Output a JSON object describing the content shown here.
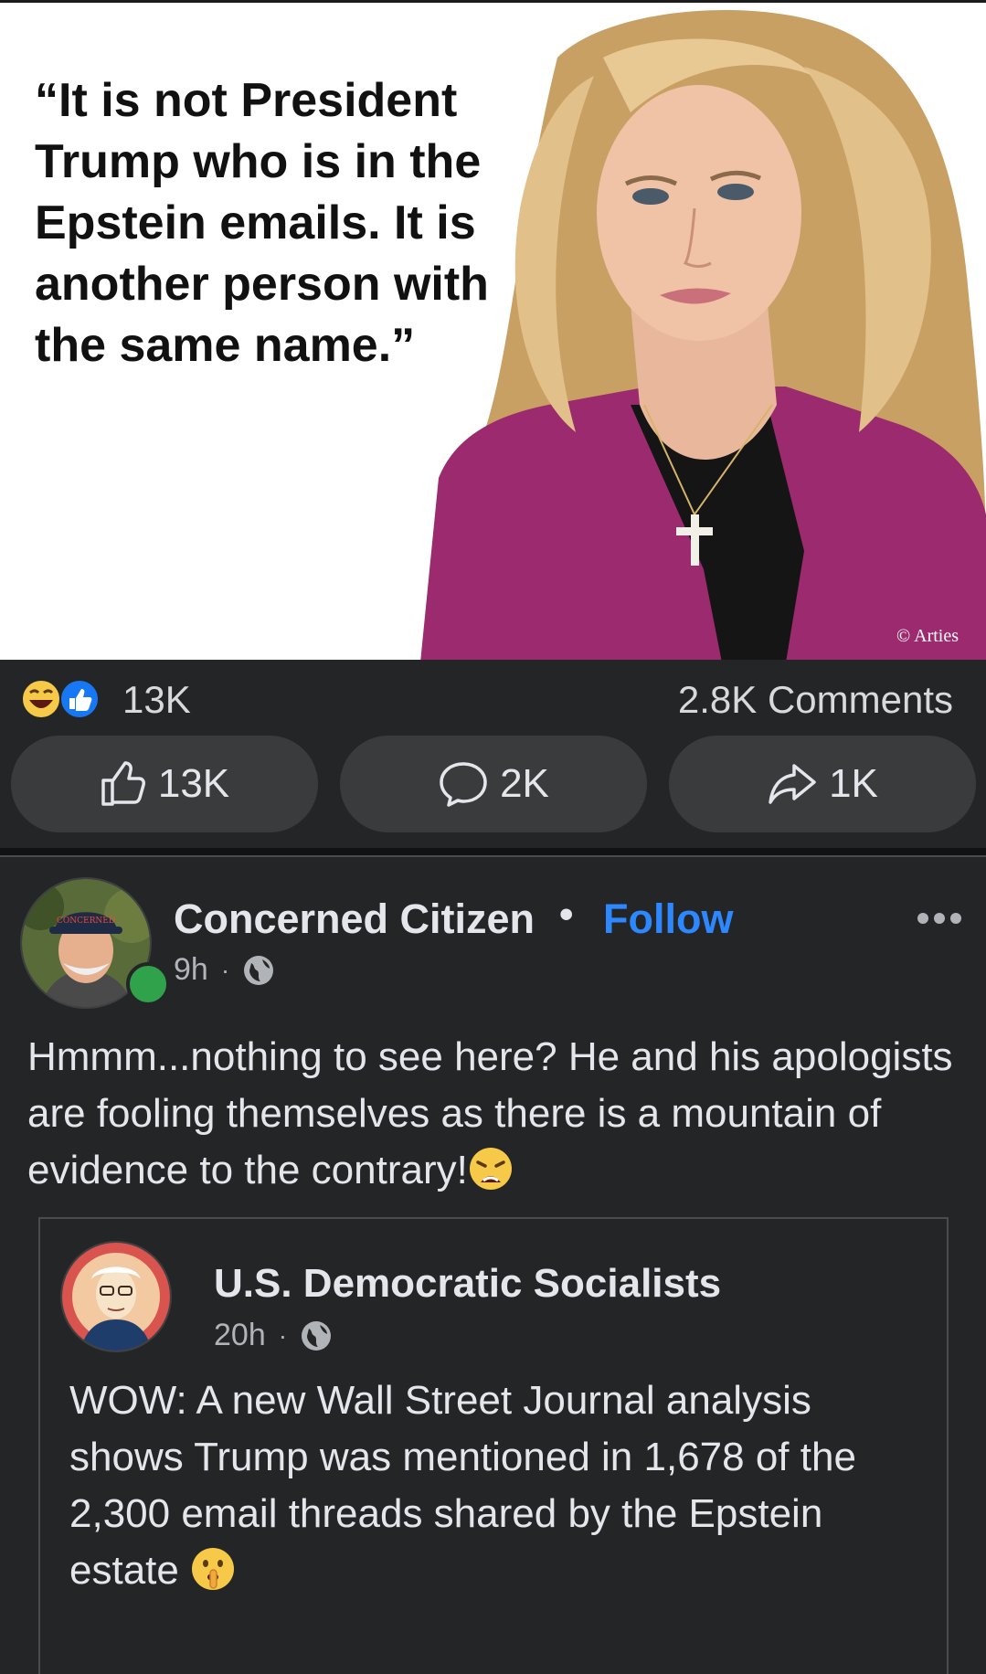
{
  "meme": {
    "quote": "“It is not President\nTrump who is in the\nEpstein emails. It is\nanother person with\nthe same name.”",
    "credit": "© Arties"
  },
  "reactions": {
    "summary_count": "13K",
    "comments": "2.8K Comments",
    "icons": [
      "laughing-emoji-icon",
      "like-icon"
    ]
  },
  "actions": {
    "like_count": "13K",
    "comment_count": "2K",
    "share_count": "1K"
  },
  "post": {
    "author": "Concerned Citizen",
    "separator": "•",
    "follow_label": "Follow",
    "time": "9h",
    "meta_sep": "·",
    "privacy_icon": "globe-icon",
    "text": "Hmmm...nothing to see here? He and his apologists are fooling themselves as there is a mountain of evidence to the contrary!",
    "text_emoji": "weary-face-emoji"
  },
  "shared_post": {
    "author": "U.S. Democratic Socialists",
    "time": "20h",
    "meta_sep": "·",
    "privacy_icon": "globe-icon",
    "text": "WOW: A new Wall Street Journal analysis shows Trump was mentioned in 1,678 of the 2,300 email threads shared by the Epstein estate ",
    "text_emoji": "shushing-face-emoji"
  },
  "colors": {
    "background": "#242526",
    "button": "#3a3b3c",
    "follow": "#2d88ff",
    "online": "#31a24c",
    "blazer": "#9c2a6e",
    "hair": "#d9b47a"
  }
}
